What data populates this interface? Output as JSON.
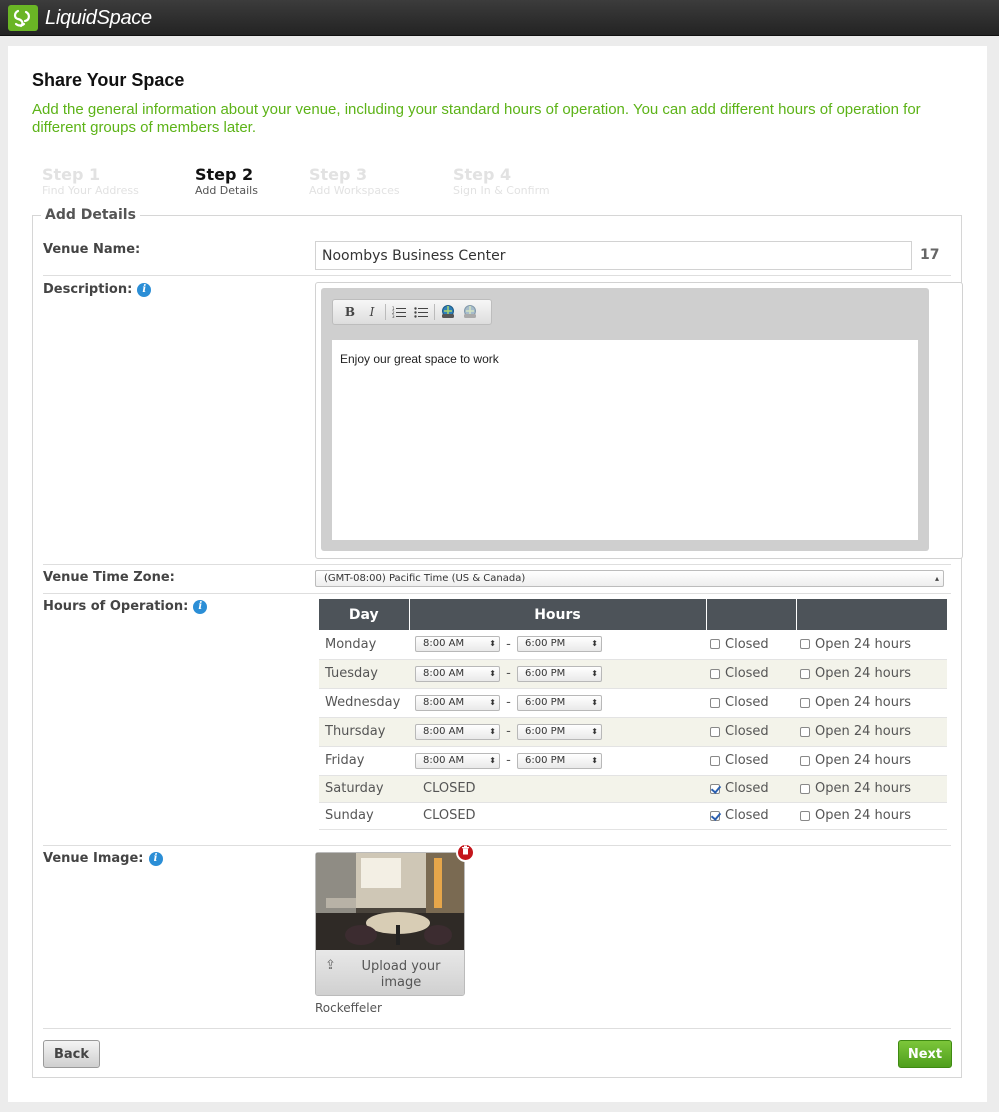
{
  "app": {
    "name": "LiquidSpace",
    "brand_color": "#6ab525"
  },
  "header": {
    "title": "Share Your Space",
    "intro": "Add the general information about your venue, including your standard hours of operation. You can add different hours of operation for different groups of members later."
  },
  "steps": [
    {
      "title": "Step 1",
      "subtitle": "Find Your Address",
      "active": false
    },
    {
      "title": "Step 2",
      "subtitle": "Add Details",
      "active": true
    },
    {
      "title": "Step 3",
      "subtitle": "Add Workspaces",
      "active": false
    },
    {
      "title": "Step 4",
      "subtitle": "Sign In & Confirm",
      "active": false
    }
  ],
  "form": {
    "legend": "Add Details",
    "venue_name": {
      "label": "Venue Name:",
      "value": "Noombys Business Center",
      "char_count": "17"
    },
    "description": {
      "label": "Description:",
      "toolbar": {
        "bold": "B",
        "italic": "I"
      },
      "value": "Enjoy our great space to work"
    },
    "time_zone": {
      "label": "Venue Time Zone:",
      "value": "(GMT-08:00) Pacific Time (US & Canada)"
    },
    "hours": {
      "label": "Hours of Operation:",
      "headers": [
        "Day",
        "Hours",
        "",
        ""
      ],
      "closed_label": "Closed",
      "open24_label": "Open 24 hours",
      "closed_text": "CLOSED",
      "rows": [
        {
          "day": "Monday",
          "open": "8:00 AM",
          "close": "6:00 PM",
          "closed": false
        },
        {
          "day": "Tuesday",
          "open": "8:00 AM",
          "close": "6:00 PM",
          "closed": false
        },
        {
          "day": "Wednesday",
          "open": "8:00 AM",
          "close": "6:00 PM",
          "closed": false
        },
        {
          "day": "Thursday",
          "open": "8:00 AM",
          "close": "6:00 PM",
          "closed": false
        },
        {
          "day": "Friday",
          "open": "8:00 AM",
          "close": "6:00 PM",
          "closed": false
        },
        {
          "day": "Saturday",
          "closed": true
        },
        {
          "day": "Sunday",
          "closed": true
        }
      ]
    },
    "venue_image": {
      "label": "Venue Image:",
      "upload_label": "Upload your image",
      "caption": "Rockeffeler"
    }
  },
  "actions": {
    "back": "Back",
    "next": "Next"
  }
}
